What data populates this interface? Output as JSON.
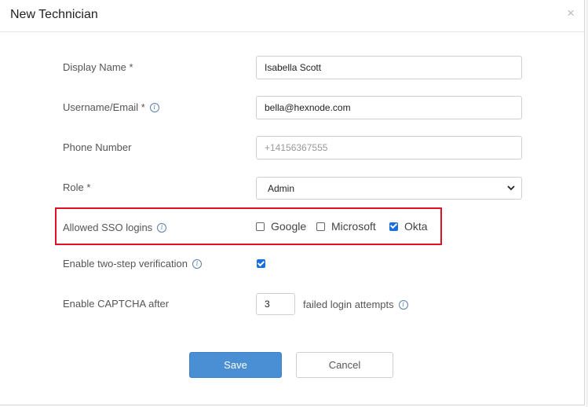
{
  "dialog": {
    "title": "New Technician",
    "close_symbol": "×"
  },
  "form": {
    "display_name": {
      "label": "Display Name *",
      "value": "Isabella Scott"
    },
    "username": {
      "label": "Username/Email *",
      "value": "bella@hexnode.com"
    },
    "phone": {
      "label": "Phone Number",
      "placeholder": "+14156367555"
    },
    "role": {
      "label": "Role *",
      "value": "Admin"
    },
    "sso": {
      "label": "Allowed SSO logins",
      "options": [
        {
          "label": "Google",
          "checked": false
        },
        {
          "label": "Microsoft",
          "checked": false
        },
        {
          "label": "Okta",
          "checked": true
        }
      ]
    },
    "two_step": {
      "label": "Enable two-step verification",
      "checked": true
    },
    "captcha": {
      "label": "Enable CAPTCHA after",
      "value": "3",
      "suffix": "failed login attempts"
    }
  },
  "buttons": {
    "save": "Save",
    "cancel": "Cancel"
  },
  "icons": {
    "info": "info-icon",
    "close": "close-icon",
    "dropdown": "chevron-down-icon"
  },
  "colors": {
    "highlight": "#e0141e",
    "primary": "#4a8fd4",
    "checkbox": "#1a6fe0"
  }
}
